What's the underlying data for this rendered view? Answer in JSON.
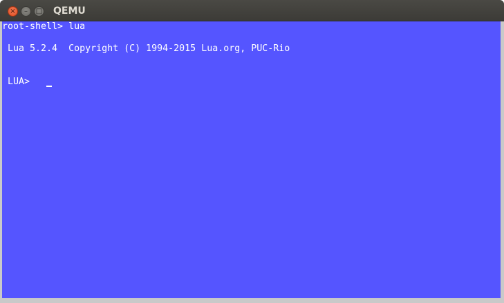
{
  "window": {
    "title": "QEMU",
    "buttons": {
      "close": "×",
      "minimize": "–",
      "maximize": "□"
    }
  },
  "terminal": {
    "background": "#5555ff",
    "foreground": "#ffffff",
    "lines": [
      "root-shell> lua",
      " Lua 5.2.4  Copyright (C) 1994-2015 Lua.org, PUC-Rio",
      " LUA>"
    ]
  }
}
